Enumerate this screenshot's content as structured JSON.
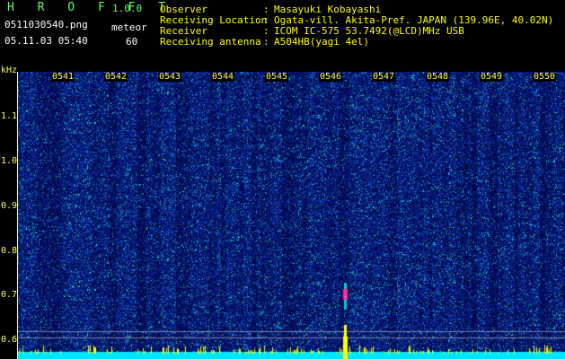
{
  "header": {
    "app_title": "H R O F F T",
    "version": "1.0.0",
    "file_name": "0511030540.png",
    "date_time": "05.11.03 05:40",
    "meteor_label": "meteor",
    "meteor_count": "60"
  },
  "info": [
    {
      "key": "Observer",
      "value": "Masayuki Kobayashi"
    },
    {
      "key": "Receiving Location",
      "value": "Ogata-vill. Akita-Pref. JAPAN (139.96E, 40.02N)"
    },
    {
      "key": "Receiver",
      "value": "ICOM IC-575 53.7492(@LCD)MHz USB"
    },
    {
      "key": "Receiving antenna",
      "value": "A504HB(yagi 4el)"
    }
  ],
  "y_axis": {
    "unit_label": "kHz",
    "ticks": [
      "1.1",
      "1.0",
      "0.9",
      "0.8",
      "0.7",
      "0.6"
    ]
  },
  "x_axis": {
    "ticks": [
      "0541",
      "0542",
      "0543",
      "0544",
      "0545",
      "0546",
      "0547",
      "0548",
      "0549",
      "0550"
    ]
  },
  "colors": {
    "background": "#000000",
    "title_green": "#66ff66",
    "info_yellow": "#ffff00",
    "axis_yellow": "#ffff66",
    "spectrum_base": "#0a1f8c",
    "noise_cyan": "#00e5ff",
    "meteor_magenta": "#ff2a9a",
    "signal_yellow": "#ffff00"
  }
}
